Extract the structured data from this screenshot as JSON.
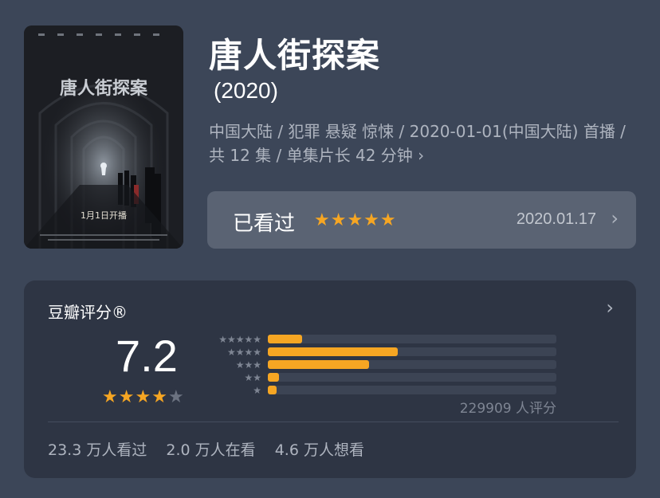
{
  "movie": {
    "title": "唐人街探案",
    "year": "(2020)",
    "meta": "中国大陆 / 犯罪 悬疑 惊悚 / 2020-01-01(中国大陆) 首播 / 共 12 集 / 单集片长 42 分钟",
    "poster": {
      "title_art": "唐人街探案",
      "caption": "1月1日开播"
    }
  },
  "watched": {
    "label": "已看过",
    "stars": "★★★★★",
    "date": "2020.01.17"
  },
  "rating": {
    "header": "豆瓣评分®",
    "score": "7.2",
    "stars_full": 3,
    "stars_half": 1,
    "stars_empty": 1,
    "distribution": [
      {
        "stars": "★★★★★",
        "percent": 12.0
      },
      {
        "stars": "★★★★",
        "percent": 45.0
      },
      {
        "stars": "★★★",
        "percent": 35.0
      },
      {
        "stars": "★★",
        "percent": 4.0
      },
      {
        "stars": "★",
        "percent": 3.0
      }
    ],
    "count_text": "229909 人评分",
    "stats": [
      "23.3 万人看过",
      "2.0 万人在看",
      "4.6 万人想看"
    ]
  },
  "colors": {
    "accent": "#f6a623",
    "background": "#3c4658",
    "card": "#2e3544"
  }
}
